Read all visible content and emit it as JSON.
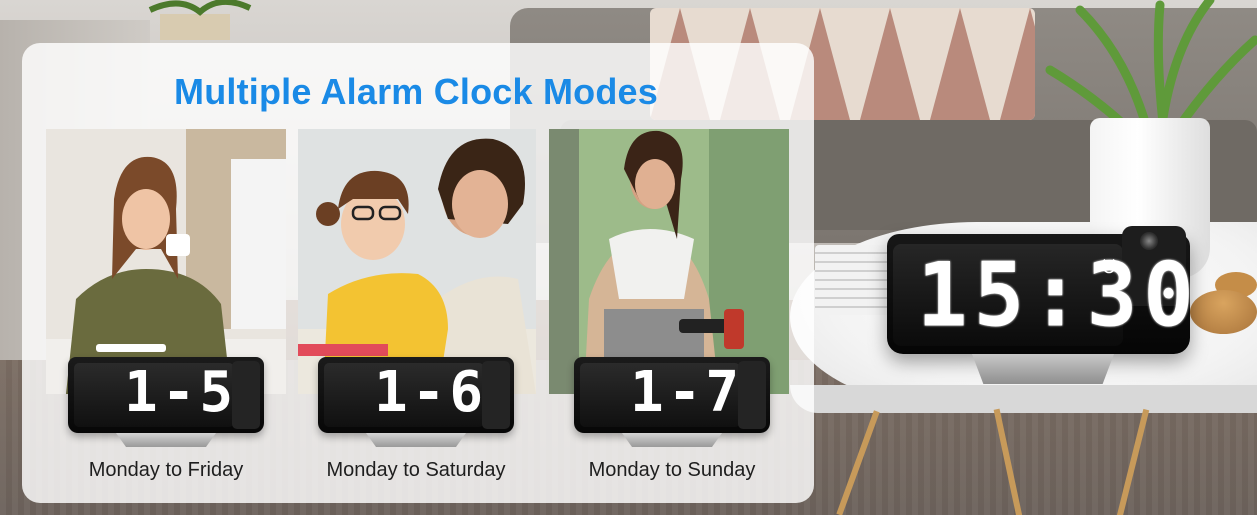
{
  "title": "Multiple Alarm Clock Modes",
  "main_clock": {
    "time": "15:30",
    "alarm_icon": "alarm-clock-icon"
  },
  "modes": [
    {
      "display": "1-5",
      "caption": "Monday to Friday"
    },
    {
      "display": "1-6",
      "caption": "Monday to Saturday"
    },
    {
      "display": "1-7",
      "caption": "Monday to Sunday"
    }
  ],
  "colors": {
    "title": "#1a8ae6",
    "clock_digits": "#ffffff",
    "clock_body": "#0a0a0a"
  }
}
